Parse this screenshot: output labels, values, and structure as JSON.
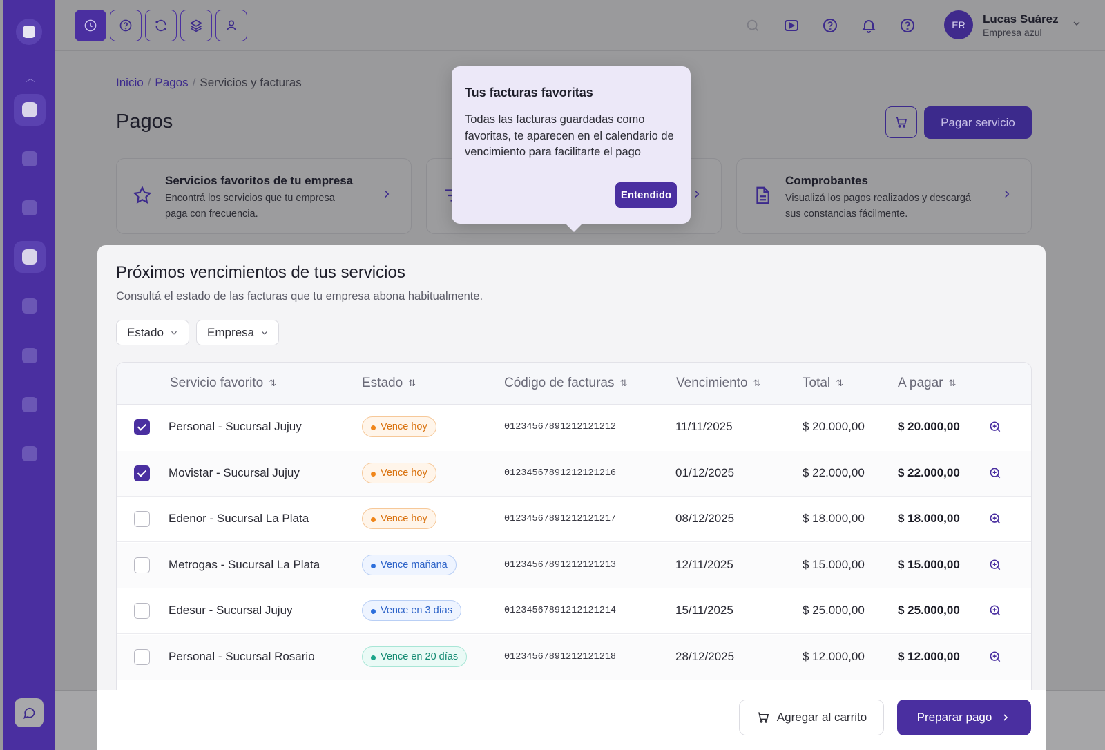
{
  "header": {
    "user_initials": "ER",
    "user_name": "Lucas Suárez",
    "user_company": "Empresa azul"
  },
  "breadcrumb": {
    "items": [
      "Inicio",
      "Pagos",
      "Servicios y facturas"
    ]
  },
  "page": {
    "title": "Pagos",
    "pay_service_label": "Pagar servicio"
  },
  "cards": [
    {
      "title": "Servicios favoritos de tu empresa",
      "description": "Encontrá los servicios que tu empresa paga con frecuencia."
    },
    {
      "title": "Comprobantes",
      "description": "Visualizá los pagos realizados y descargá sus constancias fácilmente."
    }
  ],
  "popover": {
    "title": "Tus facturas favoritas",
    "text": "Todas las facturas guardadas como favoritas, te aparecen en el calendario de vencimiento para facilitarte el pago",
    "button": "Entendido"
  },
  "panel": {
    "title": "Próximos vencimientos de tus servicios",
    "subtitle": "Consultá el estado de las facturas que tu empresa abona habitualmente.",
    "filters": [
      "Estado",
      "Empresa"
    ]
  },
  "table": {
    "columns": [
      "Servicio favorito",
      "Estado",
      "Código de facturas",
      "Vencimiento",
      "Total",
      "A pagar"
    ],
    "rows": [
      {
        "checked": true,
        "service": "Personal - Sucursal Jujuy",
        "status": "Vence hoy",
        "status_color": "orange",
        "code": "01234567891212121212",
        "due": "11/11/2025",
        "total": "$ 20.000,00",
        "to_pay": "$ 20.000,00"
      },
      {
        "checked": true,
        "service": "Movistar - Sucursal Jujuy",
        "status": "Vence hoy",
        "status_color": "orange",
        "code": "01234567891212121216",
        "due": "01/12/2025",
        "total": "$ 22.000,00",
        "to_pay": "$ 22.000,00"
      },
      {
        "checked": false,
        "service": "Edenor - Sucursal La Plata",
        "status": "Vence hoy",
        "status_color": "orange",
        "code": "01234567891212121217",
        "due": "08/12/2025",
        "total": "$ 18.000,00",
        "to_pay": "$ 18.000,00"
      },
      {
        "checked": false,
        "service": "Metrogas - Sucursal La Plata",
        "status": "Vence mañana",
        "status_color": "blue",
        "code": "01234567891212121213",
        "due": "12/11/2025",
        "total": "$ 15.000,00",
        "to_pay": "$ 15.000,00"
      },
      {
        "checked": false,
        "service": "Edesur - Sucursal Jujuy",
        "status": "Vence en 3 días",
        "status_color": "blue",
        "code": "01234567891212121214",
        "due": "15/11/2025",
        "total": "$ 25.000,00",
        "to_pay": "$ 25.000,00"
      },
      {
        "checked": false,
        "service": "Personal - Sucursal Rosario",
        "status": "Vence en 20 días",
        "status_color": "teal",
        "code": "01234567891212121218",
        "due": "28/12/2025",
        "total": "$ 12.000,00",
        "to_pay": "$ 12.000,00"
      }
    ]
  },
  "footer": {
    "add_cart_label": "Agregar al carrito",
    "prepare_pay_label": "Preparar pago"
  },
  "colors": {
    "primary": "#4a2fa0",
    "overlay": "#9a9a9c"
  }
}
